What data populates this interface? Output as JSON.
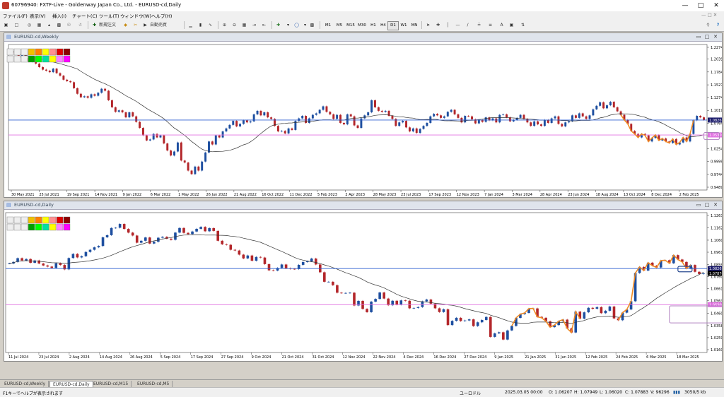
{
  "window": {
    "title": "60796940: FXTF-Live - Goldenway Japan Co., Ltd. - EURUSD-cd,Daily"
  },
  "menu": [
    "ファイル(F)",
    "表示(V)",
    "挿入(I)",
    "チャート(C)",
    "ツール(T)",
    "ウィンドウ(W)",
    "ヘルプ(H)"
  ],
  "toolbar": {
    "new_order": "新規注文",
    "auto_trade": "自動売買",
    "timeframes": [
      "M1",
      "M5",
      "M15",
      "M30",
      "H1",
      "H4",
      "D1",
      "W1",
      "MN"
    ],
    "active_timeframe": "D1"
  },
  "colors": {
    "bull": "#1e4fa0",
    "bear": "#b3262a",
    "ma": "#333333",
    "resistance": "#2f5fd0",
    "support": "#e070e0",
    "pattern": "#f08a24"
  },
  "weekly": {
    "title": "EURUSD-cd,Weekly",
    "x_labels": [
      "30 May 2021",
      "25 Jul 2021",
      "19 Sep 2021",
      "14 Nov 2021",
      "9 Jan 2022",
      "6 Mar 2022",
      "1 May 2022",
      "26 Jun 2022",
      "21 Aug 2022",
      "16 Oct 2022",
      "11 Dec 2022",
      "5 Feb 2023",
      "2 Apr 2023",
      "28 May 2023",
      "23 Jul 2023",
      "17 Sep 2023",
      "12 Nov 2023",
      "7 Jan 2024",
      "3 Mar 2024",
      "28 Apr 2024",
      "23 Jun 2024",
      "18 Aug 2024",
      "13 Oct 2024",
      "8 Dec 2024",
      "2 Feb 2025"
    ],
    "y_labels": [
      "1.22745",
      "1.20390",
      "1.17845",
      "1.15275",
      "1.12745",
      "1.10195",
      "1.07645",
      "1.05095",
      "1.02545",
      "0.99995",
      "0.97445",
      "0.94895"
    ],
    "price_tag": "1.08267",
    "support_tag": "1.05300"
  },
  "daily": {
    "title": "EURUSD-cd,Daily",
    "x_labels": [
      "11 Jul 2024",
      "23 Jul 2024",
      "2 Aug 2024",
      "14 Aug 2024",
      "26 Aug 2024",
      "5 Sep 2024",
      "17 Sep 2024",
      "27 Sep 2024",
      "9 Oct 2024",
      "21 Oct 2024",
      "31 Oct 2024",
      "12 Nov 2024",
      "22 Nov 2024",
      "4 Dec 2024",
      "16 Dec 2024",
      "27 Dec 2024",
      "9 Jan 2025",
      "21 Jan 2025",
      "31 Jan 2025",
      "12 Feb 2025",
      "24 Feb 2025",
      "6 Mar 2025",
      "18 Mar 2025"
    ],
    "y_labels": [
      "1.12630",
      "1.11620",
      "1.10600",
      "1.09610",
      "1.08590",
      "1.07870",
      "1.07600",
      "1.06610",
      "1.05630",
      "1.04600",
      "1.03580",
      "1.02590",
      "1.01600"
    ],
    "price_tag": "1.08267",
    "price_tag2": "1.07870",
    "support_tag": "1.05300"
  },
  "chart_data": [
    {
      "type": "candlestick",
      "title": "EURUSD-cd,Weekly",
      "ylim": [
        0.94895,
        1.22745
      ],
      "ma_period": "unlabeled",
      "close": [
        1.22,
        1.214,
        1.207,
        1.212,
        1.206,
        1.199,
        1.208,
        1.195,
        1.188,
        1.183,
        1.181,
        1.178,
        1.185,
        1.176,
        1.171,
        1.163,
        1.16,
        1.158,
        1.146,
        1.135,
        1.128,
        1.13,
        1.127,
        1.134,
        1.131,
        1.137,
        1.145,
        1.141,
        1.122,
        1.108,
        1.099,
        1.102,
        1.098,
        1.088,
        1.098,
        1.09,
        1.079,
        1.067,
        1.052,
        1.042,
        1.044,
        1.055,
        1.048,
        1.052,
        1.036,
        1.022,
        1.012,
        1.02,
        1.038,
        1.002,
        0.998,
        0.982,
        0.975,
        0.99,
        0.982,
        1.0,
        1.018,
        1.04,
        1.034,
        1.052,
        1.048,
        1.06,
        1.066,
        1.073,
        1.081,
        1.07,
        1.075,
        1.082,
        1.078,
        1.08,
        1.094,
        1.101,
        1.092,
        1.098,
        1.088,
        1.085,
        1.071,
        1.06,
        1.061,
        1.056,
        1.066,
        1.063,
        1.081,
        1.086,
        1.091,
        1.077,
        1.086,
        1.093,
        1.096,
        1.103,
        1.11,
        1.099,
        1.094,
        1.085,
        1.093,
        1.077,
        1.074,
        1.094,
        1.09,
        1.072,
        1.067,
        1.086,
        1.092,
        1.098,
        1.122,
        1.108,
        1.101,
        1.099,
        1.101,
        1.091,
        1.085,
        1.071,
        1.078,
        1.081,
        1.068,
        1.06,
        1.066,
        1.057,
        1.065,
        1.071,
        1.077,
        1.09,
        1.095,
        1.092,
        1.087,
        1.09,
        1.099,
        1.103,
        1.094,
        1.087,
        1.078,
        1.091,
        1.09,
        1.084,
        1.076,
        1.083,
        1.079,
        1.088,
        1.082,
        1.086,
        1.078,
        1.093,
        1.094,
        1.088,
        1.08,
        1.083,
        1.087,
        1.093,
        1.085,
        1.078,
        1.071,
        1.08,
        1.074,
        1.071,
        1.083,
        1.077,
        1.086,
        1.09,
        1.075,
        1.07,
        1.078,
        1.08,
        1.092,
        1.087,
        1.096,
        1.09,
        1.085,
        1.092,
        1.104,
        1.111,
        1.118,
        1.106,
        1.112,
        1.119,
        1.108,
        1.1,
        1.093,
        1.083,
        1.075,
        1.061,
        1.055,
        1.048,
        1.055,
        1.052,
        1.04,
        1.047,
        1.053,
        1.042,
        1.046,
        1.04,
        1.037,
        1.045,
        1.034,
        1.038,
        1.048,
        1.04,
        1.055,
        1.082,
        1.091,
        1.088,
        1.083
      ]
    },
    {
      "type": "candlestick",
      "title": "EURUSD-cd,Daily",
      "ylim": [
        1.016,
        1.1263
      ],
      "ma_period": "unlabeled",
      "close": [
        1.0868,
        1.0881,
        1.0912,
        1.0893,
        1.0905,
        1.0874,
        1.0893,
        1.0868,
        1.0852,
        1.0843,
        1.0832,
        1.087,
        1.0856,
        1.082,
        1.0913,
        1.0947,
        1.0918,
        1.0928,
        1.0963,
        1.0981,
        1.1001,
        1.1012,
        1.1083,
        1.1101,
        1.116,
        1.1162,
        1.1193,
        1.1152,
        1.1122,
        1.1098,
        1.1039,
        1.1055,
        1.1082,
        1.1032,
        1.1047,
        1.108,
        1.1087,
        1.1072,
        1.1063,
        1.1122,
        1.116,
        1.112,
        1.111,
        1.1131,
        1.1153,
        1.1169,
        1.1133,
        1.1159,
        1.1136,
        1.1055,
        1.1026,
        1.1022,
        1.0981,
        1.0975,
        1.0941,
        1.091,
        1.0934,
        1.0891,
        1.0922,
        1.0917,
        1.0863,
        1.0812,
        1.081,
        1.0832,
        1.086,
        1.0829,
        1.0824,
        1.0822,
        1.0857,
        1.088,
        1.0886,
        1.0909,
        1.086,
        1.0796,
        1.0718,
        1.0718,
        1.069,
        1.0628,
        1.0625,
        1.0626,
        1.0628,
        1.0523,
        1.0561,
        1.0495,
        1.0468,
        1.0555,
        1.0577,
        1.063,
        1.058,
        1.0525,
        1.0562,
        1.053,
        1.0565,
        1.0562,
        1.05,
        1.0503,
        1.051,
        1.0557,
        1.0572,
        1.0538,
        1.05,
        1.0469,
        1.0492,
        1.0362,
        1.0397,
        1.0422,
        1.0395,
        1.04,
        1.0409,
        1.0354,
        1.0385,
        1.0404,
        1.0429,
        1.0265,
        1.0294,
        1.0303,
        1.0243,
        1.0318,
        1.0355,
        1.0421,
        1.0452,
        1.0462,
        1.0497,
        1.0499,
        1.043,
        1.0422,
        1.0393,
        1.0345,
        1.0362,
        1.0394,
        1.0407,
        1.0335,
        1.0301,
        1.0473,
        1.0415,
        1.0467,
        1.0504,
        1.0496,
        1.051,
        1.046,
        1.048,
        1.0515,
        1.0417,
        1.0402,
        1.0464,
        1.049,
        1.0558,
        1.079,
        1.084,
        1.081,
        1.0875,
        1.085,
        1.0835,
        1.0892,
        1.0895,
        1.087,
        1.0937,
        1.0901,
        1.0881,
        1.0827,
        1.0856,
        1.08,
        1.0782,
        1.0787
      ]
    }
  ],
  "tabs": [
    "EURUSD-cd,Weekly",
    "EURUSD-cd,Daily",
    "EURUSD-cd,M15",
    "EURUSD-cd,M5"
  ],
  "active_tab": "EURUSD-cd,Daily",
  "status": {
    "help": "F1キーでヘルプが表示されます",
    "profile": "ユーロドル",
    "datetime": "2025.03.05 00:00",
    "open": "O: 1.06207",
    "high": "H: 1.07949",
    "low": "L: 1.06020",
    "close": "C: 1.07883",
    "volume": "V: 96296",
    "traffic": "3050/5 kb"
  }
}
